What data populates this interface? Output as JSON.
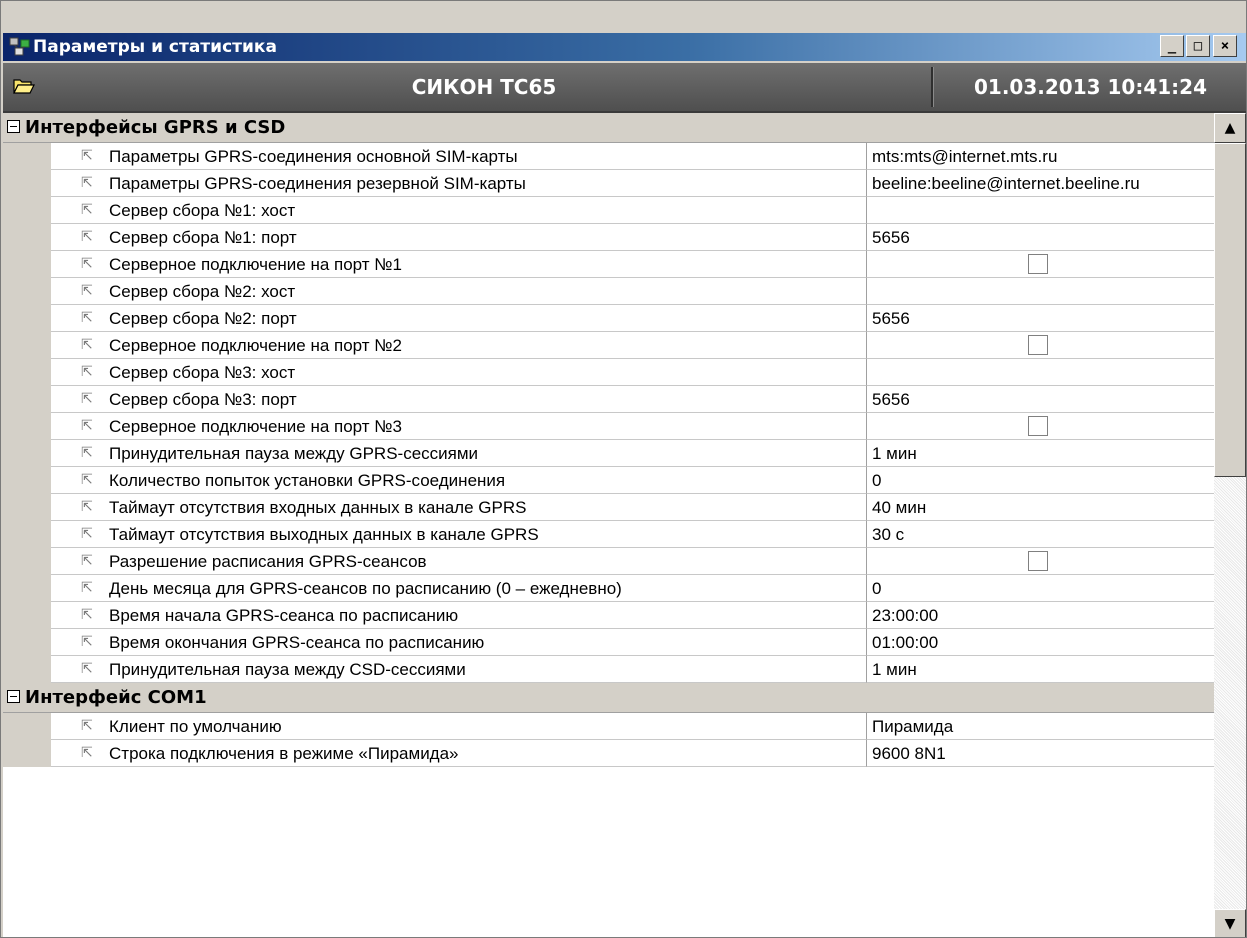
{
  "window": {
    "title": "Параметры и статистика",
    "min_glyph": "_",
    "max_glyph": "□",
    "close_glyph": "×"
  },
  "header": {
    "device_name": "СИКОН ТС65",
    "datetime": "01.03.2013 10:41:24"
  },
  "sections": [
    {
      "label": "Интерфейсы GPRS и CSD",
      "rows": [
        {
          "name": "Параметры GPRS-соединения основной SIM-карты",
          "value": "mts:mts@internet.mts.ru"
        },
        {
          "name": "Параметры GPRS-соединения резервной SIM-карты",
          "value": "beeline:beeline@internet.beeline.ru"
        },
        {
          "name": "Сервер сбора №1: хост",
          "value": ""
        },
        {
          "name": "Сервер сбора №1: порт",
          "value": "5656"
        },
        {
          "name": "Серверное подключение на порт №1",
          "checkbox": true,
          "checked": false
        },
        {
          "name": "Сервер сбора №2: хост",
          "value": ""
        },
        {
          "name": "Сервер сбора №2: порт",
          "value": "5656"
        },
        {
          "name": "Серверное подключение на порт №2",
          "checkbox": true,
          "checked": false
        },
        {
          "name": "Сервер сбора №3: хост",
          "value": ""
        },
        {
          "name": "Сервер сбора №3: порт",
          "value": "5656"
        },
        {
          "name": "Серверное подключение на порт №3",
          "checkbox": true,
          "checked": false
        },
        {
          "name": "Принудительная пауза между GPRS-сессиями",
          "value": "1 мин"
        },
        {
          "name": "Количество попыток установки GPRS-соединения",
          "value": "0"
        },
        {
          "name": "Таймаут отсутствия входных данных в канале GPRS",
          "value": "40 мин"
        },
        {
          "name": "Таймаут отсутствия выходных данных в канале GPRS",
          "value": "30 с"
        },
        {
          "name": "Разрешение расписания GPRS-сеансов",
          "checkbox": true,
          "checked": false
        },
        {
          "name": "День месяца для GPRS-сеансов по расписанию (0 – ежедневно)",
          "value": "0"
        },
        {
          "name": "Время начала GPRS-сеанса по расписанию",
          "value": "23:00:00"
        },
        {
          "name": "Время окончания GPRS-сеанса по расписанию",
          "value": "01:00:00"
        },
        {
          "name": "Принудительная пауза между CSD-сессиями",
          "value": "1 мин"
        }
      ]
    },
    {
      "label": "Интерфейс COM1",
      "rows": [
        {
          "name": "Клиент по умолчанию",
          "value": "Пирамида"
        },
        {
          "name": "Строка подключения в режиме «Пирамида»",
          "value": "9600 8N1"
        }
      ]
    }
  ],
  "scrollbar": {
    "up_glyph": "▲",
    "down_glyph": "▼"
  }
}
